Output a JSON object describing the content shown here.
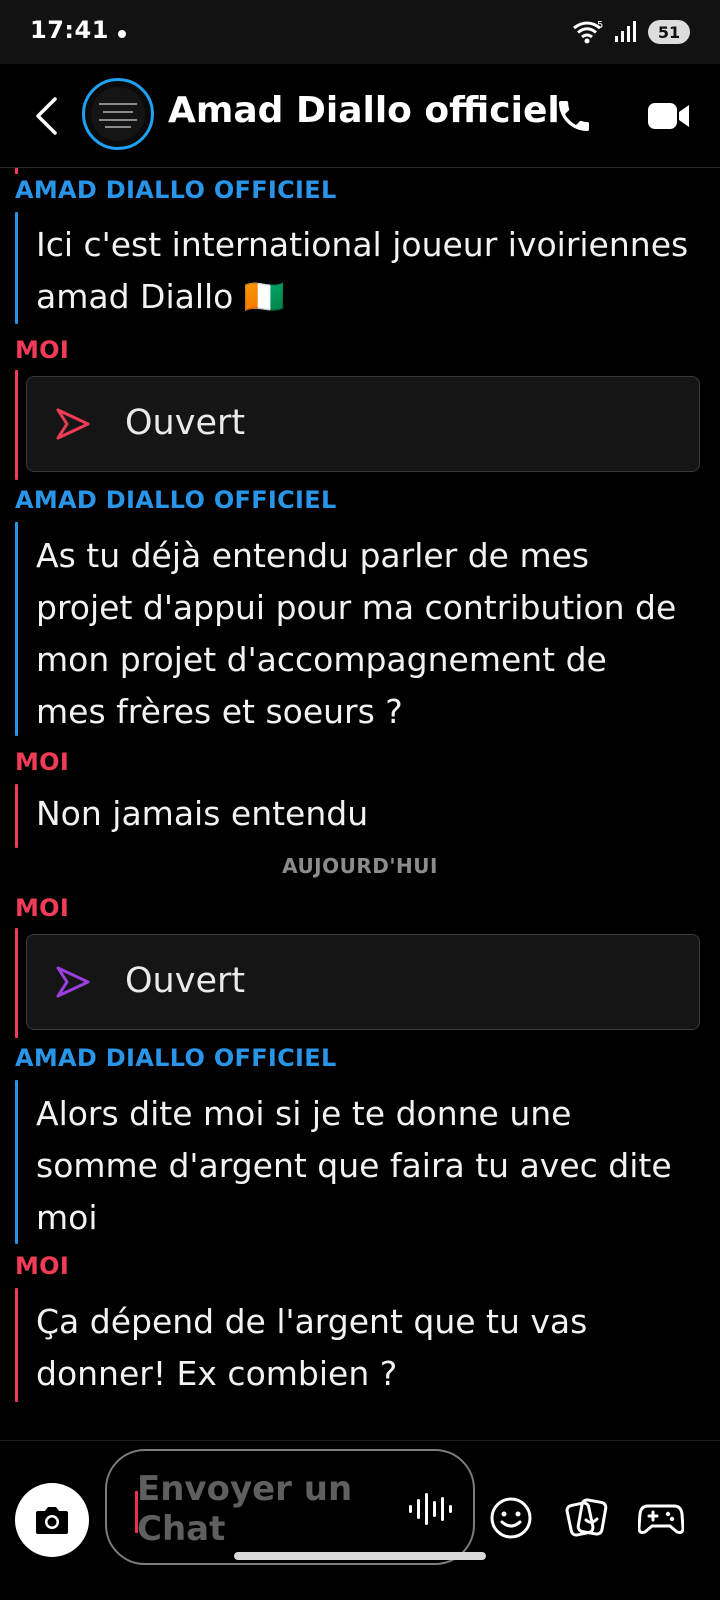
{
  "status_bar": {
    "time": "17:41",
    "battery": "51"
  },
  "header": {
    "title": "Amad Diallo officiel"
  },
  "messages": [
    {
      "sender": "AMAD DIALLO OFFICIEL",
      "lines": [
        "Ici c'est international joueur ivoiriennes",
        "amad Diallo 🇨🇮"
      ]
    },
    {
      "sender": "MOI",
      "opened": "Ouvert",
      "arrow_color": "#f23c57"
    },
    {
      "sender": "AMAD DIALLO OFFICIEL",
      "lines": [
        "As tu déjà entendu parler de mes",
        "projet d'appui pour ma contribution de",
        "mon projet d'accompagnement de",
        "mes frères et soeurs ?"
      ]
    },
    {
      "sender": "MOI",
      "lines": [
        "Non jamais entendu"
      ]
    },
    {
      "sender": "MOI",
      "opened": "Ouvert",
      "arrow_color": "#9b3fe0"
    },
    {
      "sender": "AMAD DIALLO OFFICIEL",
      "lines": [
        "Alors dite moi si je te donne une",
        "somme d'argent que faira tu avec dite",
        "moi"
      ]
    },
    {
      "sender": "MOI",
      "lines": [
        "Ça dépend de l'argent que tu vas",
        "donner! Ex combien ?"
      ]
    }
  ],
  "date_separator": "AUJOURD'HUI",
  "composer": {
    "placeholder": "Envoyer un Chat"
  },
  "colors": {
    "them": "#2995e8",
    "me": "#f23c57",
    "background": "#000000"
  },
  "icons": [
    "wifi-icon",
    "signal-icon",
    "back-arrow-icon",
    "phone-icon",
    "video-camera-icon",
    "camera-icon",
    "microphone-icon",
    "emoji-icon",
    "stickers-icon",
    "game-controller-icon"
  ]
}
